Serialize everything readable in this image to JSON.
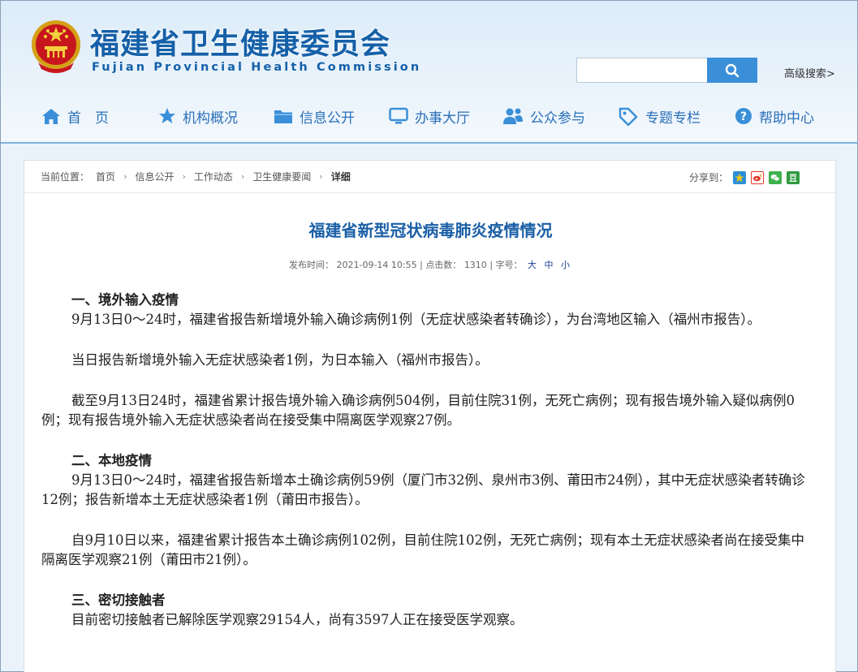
{
  "header": {
    "title": "福建省卫生健康委员会",
    "subtitle": "Fujian Provincial Health Commission",
    "search": {
      "placeholder": "",
      "adv_label": "高级搜索>"
    }
  },
  "nav": [
    {
      "label": "首　页",
      "icon": "home-icon"
    },
    {
      "label": "机构概况",
      "icon": "star-icon"
    },
    {
      "label": "信息公开",
      "icon": "folder-icon"
    },
    {
      "label": "办事大厅",
      "icon": "monitor-icon"
    },
    {
      "label": "公众参与",
      "icon": "people-icon"
    },
    {
      "label": "专题专栏",
      "icon": "tag-icon"
    },
    {
      "label": "帮助中心",
      "icon": "help-icon"
    }
  ],
  "breadcrumb": {
    "prefix": "当前位置：",
    "items": [
      "首页",
      "信息公开",
      "工作动态",
      "卫生健康要闻",
      "详细"
    ]
  },
  "share": {
    "label": "分享到："
  },
  "article": {
    "title": "福建省新型冠状病毒肺炎疫情情况",
    "meta": {
      "publish_label": "发布时间：",
      "publish_time": "2021-09-14 10:55",
      "clicks_label": "点击数：",
      "clicks": "1310",
      "font_label": "字号：",
      "font_large": "大",
      "font_medium": "中",
      "font_small": "小"
    },
    "sections": {
      "s1_heading": "一、境外输入疫情",
      "s1_p1": "9月13日0～24时，福建省报告新增境外输入确诊病例1例（无症状感染者转确诊），为台湾地区输入（福州市报告）。",
      "s1_p2": "当日报告新增境外输入无症状感染者1例，为日本输入（福州市报告）。",
      "s1_p3": "截至9月13日24时，福建省累计报告境外输入确诊病例504例，目前住院31例，无死亡病例；现有报告境外输入疑似病例0例；现有报告境外输入无症状感染者尚在接受集中隔离医学观察27例。",
      "s2_heading": "二、本地疫情",
      "s2_p1": "9月13日0～24时，福建省报告新增本土确诊病例59例（厦门市32例、泉州市3例、莆田市24例），其中无症状感染者转确诊12例；报告新增本土无症状感染者1例（莆田市报告）。",
      "s2_p2": "自9月10日以来，福建省累计报告本土确诊病例102例，目前住院102例，无死亡病例；现有本土无症状感染者尚在接受集中隔离医学观察21例（莆田市21例）。",
      "s3_heading": "三、密切接触者",
      "s3_p1": "目前密切接触者已解除医学观察29154人，尚有3597人正在接受医学观察。"
    }
  },
  "colors": {
    "brand": "#1560a8",
    "nav": "#2a6fb8",
    "accent": "#3a8fd8"
  }
}
